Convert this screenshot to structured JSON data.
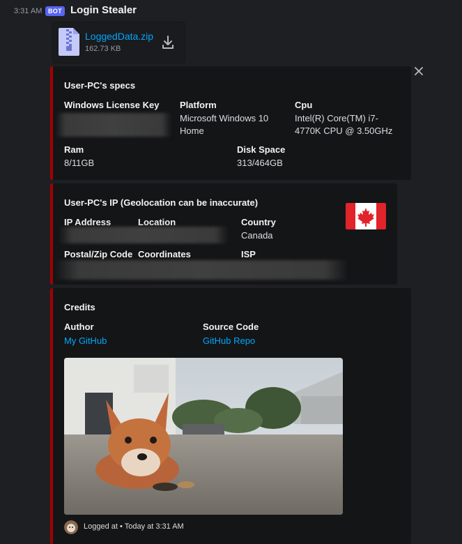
{
  "message": {
    "timestamp": "3:31 AM",
    "bot_badge": "BOT",
    "author": "Login Stealer"
  },
  "attachment": {
    "icon": "zip-file-icon",
    "file_name": "LoggedData.zip",
    "file_size": "162.73 KB",
    "download_icon": "download-icon"
  },
  "specs_embed": {
    "title": "User-PC's specs",
    "accent_color": "#a30000",
    "fields": [
      {
        "name": "Windows License Key",
        "value": ""
      },
      {
        "name": "Platform",
        "value": "Microsoft Windows 10 Home"
      },
      {
        "name": "Cpu",
        "value": "Intel(R) Core(TM) i7-4770K CPU @ 3.50GHz"
      },
      {
        "name": "Ram",
        "value": "8/11GB"
      },
      {
        "name": "Disk Space",
        "value": "313/464GB"
      }
    ]
  },
  "ip_embed": {
    "title": "User-PC's IP (Geolocation can be inaccurate)",
    "thumbnail_icon": "canada-flag-icon",
    "fields": [
      {
        "name": "IP Address",
        "value": ""
      },
      {
        "name": "Location",
        "value": ""
      },
      {
        "name": "Country",
        "value": "Canada"
      },
      {
        "name": "Postal/Zip Code",
        "value": ""
      },
      {
        "name": "Coordinates",
        "value": ""
      },
      {
        "name": "ISP",
        "value": ""
      }
    ]
  },
  "credits_embed": {
    "title": "Credits",
    "fields": [
      {
        "name": "Author",
        "value": "My GitHub"
      },
      {
        "name": "Source Code",
        "value": "GitHub Repo"
      }
    ],
    "footer_prefix": "Logged at",
    "footer_separator": "•",
    "footer_time": "Today at 3:31 AM"
  }
}
